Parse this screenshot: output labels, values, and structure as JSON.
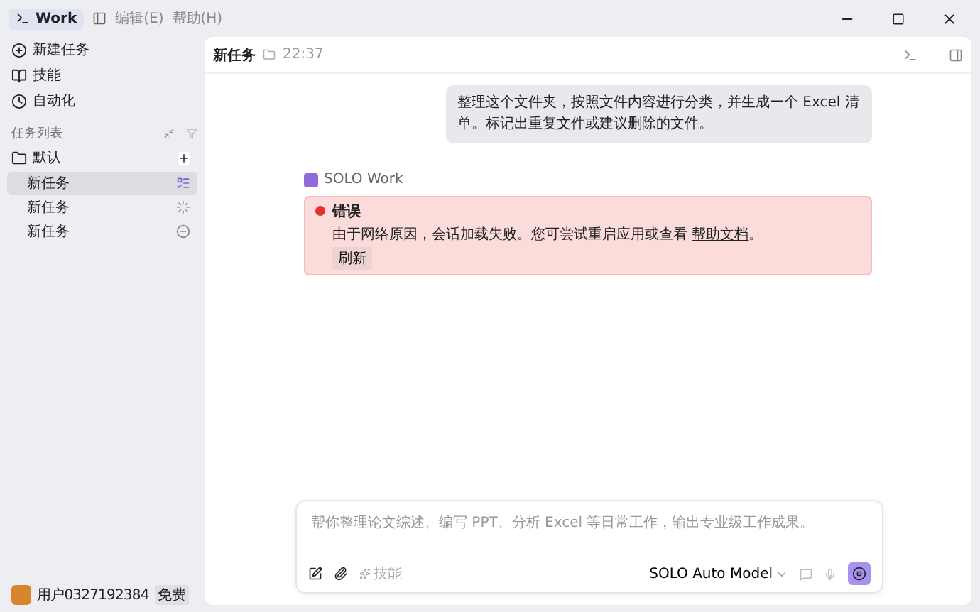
{
  "titlebar": {
    "app": "Work",
    "menus": [
      "编辑(E)",
      "帮助(H)"
    ]
  },
  "nav": [
    {
      "label": "新建任务",
      "kind": "new"
    },
    {
      "label": "技能",
      "kind": "skills"
    },
    {
      "label": "自动化",
      "kind": "auto"
    }
  ],
  "task_list": {
    "title": "任务列表",
    "folder": "默认",
    "tasks": [
      {
        "label": "新任务",
        "selected": true,
        "kind": "running"
      },
      {
        "label": "新任务",
        "selected": false,
        "kind": "loading"
      },
      {
        "label": "新任务",
        "selected": false,
        "kind": "stopped"
      }
    ]
  },
  "user": {
    "name": "用户0327192384",
    "plan": "免费"
  },
  "header": {
    "title": "新任务",
    "time": "22:37"
  },
  "user_message": "整理这个文件夹，按照文件内容进行分类，并生成一个 Excel 清单。标记出重复文件或建议删除的文件。",
  "agent": {
    "name": "SOLO Work"
  },
  "error": {
    "title": "错误",
    "message": "由于网络原因，会话加载失败。您可尝试重启应用或查看 ",
    "link": "帮助文档",
    "end": "。",
    "button": "刷新"
  },
  "composer": {
    "placeholder": "帮你整理论文综述、编写 PPT、分析 Excel 等日常工作，输出专业级工作成果。",
    "skill": "技能",
    "model": "SOLO Auto Model"
  }
}
